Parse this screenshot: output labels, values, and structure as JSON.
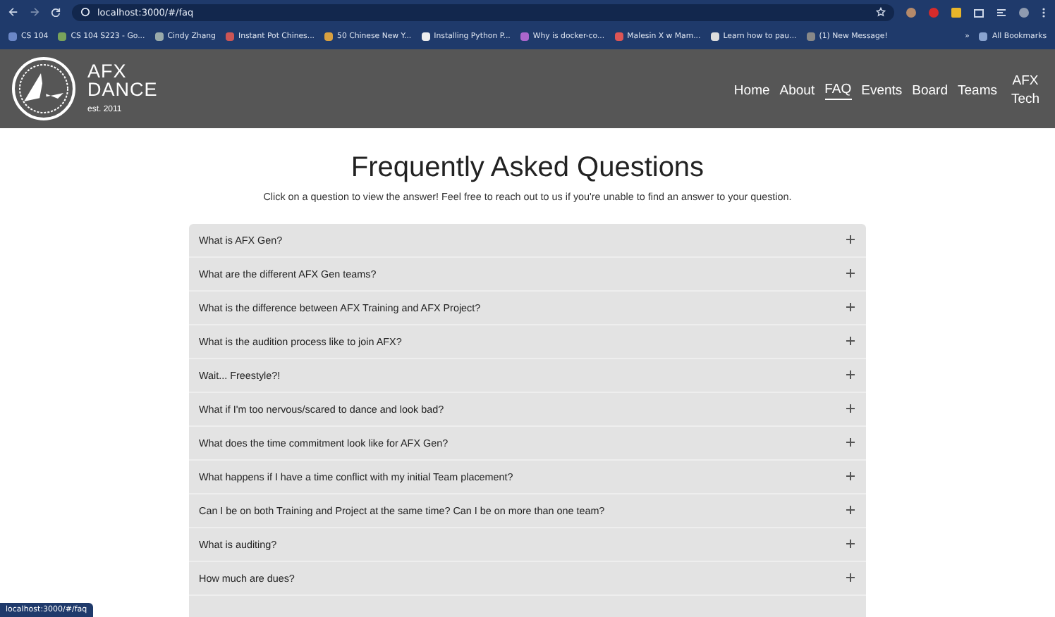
{
  "browser": {
    "url": "localhost:3000/#/faq",
    "bookmarks": [
      "CS 104",
      "CS 104 S223 - Go...",
      "Cindy Zhang",
      "Instant Pot Chines...",
      "50 Chinese New Y...",
      "Installing Python P...",
      "Why is docker-co...",
      "Malesin X w Mam...",
      "Learn how to pau...",
      "(1) New Message!"
    ],
    "more": "»",
    "all_bookmarks": "All Bookmarks",
    "status_url": "localhost:3000/#/faq"
  },
  "header": {
    "logo_lines": [
      "AFX",
      "DANCE"
    ],
    "established": "est. 2011",
    "nav": [
      {
        "label": "Home",
        "selected": false
      },
      {
        "label": "About",
        "selected": false
      },
      {
        "label": "FAQ",
        "selected": true
      },
      {
        "label": "Events",
        "selected": false
      },
      {
        "label": "Board",
        "selected": false
      },
      {
        "label": "Teams",
        "selected": false
      },
      {
        "label": "AFX Tech",
        "selected": false
      }
    ]
  },
  "page": {
    "title": "Frequently Asked Questions",
    "subtitle": "Click on a question to view the answer! Feel free to reach out to us if you're unable to find an answer to your question.",
    "faqs": [
      {
        "question": "What is AFX Gen?",
        "expanded": false
      },
      {
        "question": "What are the different AFX Gen teams?",
        "expanded": false
      },
      {
        "question": "What is the difference between AFX Training and AFX Project?",
        "expanded": false
      },
      {
        "question": "What is the audition process like to join AFX?",
        "expanded": false
      },
      {
        "question": "Wait... Freestyle?!",
        "expanded": false
      },
      {
        "question": "What if I'm too nervous/scared to dance and look bad?",
        "expanded": false
      },
      {
        "question": "What does the time commitment look like for AFX Gen?",
        "expanded": false
      },
      {
        "question": "What happens if I have a time conflict with my initial Team placement?",
        "expanded": false
      },
      {
        "question": "Can I be on both Training and Project at the same time? Can I be on more than one team?",
        "expanded": false
      },
      {
        "question": "What is auditing?",
        "expanded": false
      },
      {
        "question": "How much are dues?",
        "expanded": false
      }
    ]
  }
}
